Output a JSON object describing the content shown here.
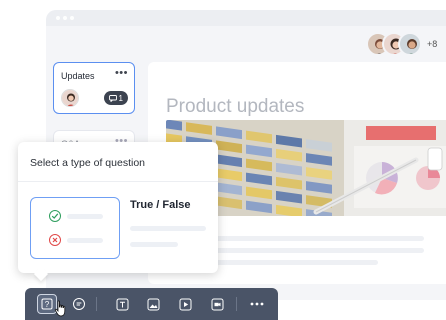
{
  "participants": {
    "extra_count": "+8"
  },
  "slides": [
    {
      "title": "Updates",
      "comment_count": "1",
      "state": "active"
    },
    {
      "title": "Q&A",
      "state": "dimmed"
    }
  ],
  "main_slide": {
    "title": "Product updates"
  },
  "question_picker": {
    "heading": "Select a type of question",
    "options": [
      {
        "label": "True / False",
        "selected": true
      }
    ]
  },
  "toolbar": {
    "tools": [
      "question-tool",
      "poll-tool",
      "text-tool",
      "image-tool",
      "video-tool",
      "record-tool",
      "more-tool"
    ],
    "active": "question-tool"
  },
  "colors": {
    "accent": "#5b8ff0",
    "toolbar_bg": "#4a5467",
    "check_green": "#2f9e5e",
    "cross_red": "#e04848"
  }
}
